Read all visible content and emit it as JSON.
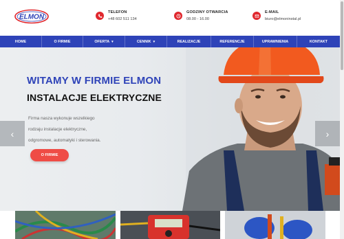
{
  "header": {
    "logo_text": "ELMON",
    "contacts": [
      {
        "icon": "phone-icon",
        "label": "TELEFON",
        "value": "+48 602 511 134"
      },
      {
        "icon": "clock-icon",
        "label": "GODZINY OTWARCIA",
        "value": "08.00 - 16.00"
      },
      {
        "icon": "envelope-icon",
        "label": "E-MAIL",
        "value": "biuro@elmoninstal.pl"
      }
    ]
  },
  "nav": {
    "items": [
      {
        "label": "HOME",
        "dropdown": false
      },
      {
        "label": "O FIRMIE",
        "dropdown": false
      },
      {
        "label": "OFERTA",
        "dropdown": true
      },
      {
        "label": "CENNIK",
        "dropdown": true
      },
      {
        "label": "REALIZACJE",
        "dropdown": false
      },
      {
        "label": "REFERENCJE",
        "dropdown": false
      },
      {
        "label": "UPRAWNIENIA",
        "dropdown": false
      },
      {
        "label": "KONTAKT",
        "dropdown": false
      }
    ],
    "color": "#2e43b8"
  },
  "hero": {
    "title": "WITAMY W FIRMIE ELMON",
    "subtitle": "INSTALACJE ELEKTRYCZNE",
    "description_lines": [
      "Firma nasza wykonuje wszelkiego",
      "rodzaju instalacje elektryczne,",
      "odgromowe, automatyki i sterowania."
    ],
    "button_label": "O FIRMIE",
    "button_color": "#ef4c46",
    "prev_arrow": "‹",
    "next_arrow": "›"
  },
  "colors": {
    "accent_blue": "#2e43b8",
    "accent_red": "#e0282e"
  }
}
